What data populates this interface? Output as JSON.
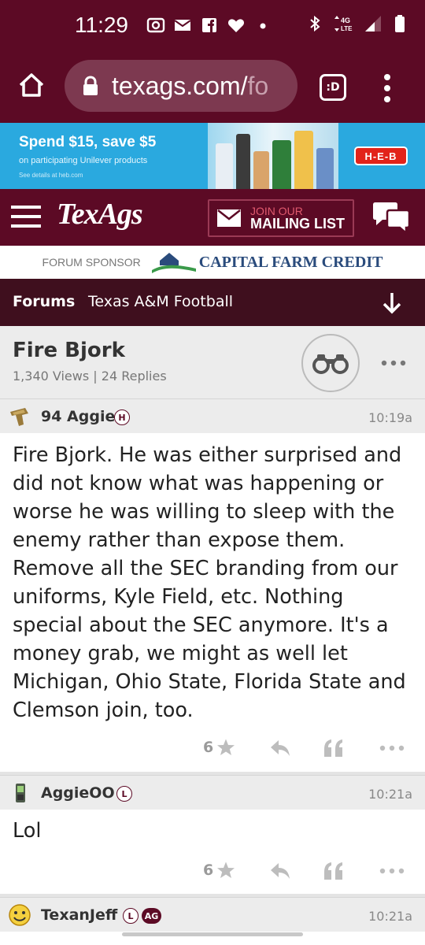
{
  "status_bar": {
    "time": "11:29",
    "icons_left": [
      "screen-record-icon",
      "mail-icon",
      "facebook-icon",
      "heart-icon",
      "dot-icon"
    ],
    "icons_right": [
      "bluetooth-icon",
      "4g-lte-icon",
      "signal-icon",
      "battery-icon"
    ],
    "network": "4G LTE"
  },
  "browser": {
    "url_main": "texags.com/",
    "url_faded": "fo",
    "discover_label": ":D"
  },
  "ad": {
    "headline": "Spend $15, save $5",
    "subline": "on participating Unilever products",
    "fine_print": "See details at heb.com",
    "brand": "H-E-B",
    "colors": {
      "background": "#2aa9df",
      "brand_red": "#e2231a"
    }
  },
  "site": {
    "logo": "TexAgs",
    "mailing_top": "JOIN OUR",
    "mailing_bottom": "MAILING LIST",
    "colors": {
      "maroon": "#5c0a25",
      "dark_maroon": "#3f0f1e"
    }
  },
  "sponsor": {
    "label": "FORUM SPONSOR",
    "name": "CAPITAL FARM CREDIT"
  },
  "breadcrumb": {
    "forums": "Forums",
    "board": "Texas A&M Football"
  },
  "thread": {
    "title": "Fire Bjork",
    "stats": "1,340 Views | 24 Replies"
  },
  "posts": [
    {
      "user": "94 Aggie",
      "badges": [
        "H"
      ],
      "time": "10:19a",
      "body": "Fire Bjork. He was either surprised and did not know what was happening or worse he was willing to sleep with the enemy rather than expose them. Remove all the SEC branding from our uniforms, Kyle Field, etc. Nothing special about the SEC anymore. It's a money grab, we might as well let Michigan, Ohio State, Florida State and Clemson join, too.",
      "rating": "6"
    },
    {
      "user": "AggieOO",
      "badges": [
        "L"
      ],
      "time": "10:21a",
      "body": "Lol",
      "rating": "6"
    },
    {
      "user": "TexanJeff",
      "badges": [
        "L",
        "AG"
      ],
      "time": "10:21a"
    }
  ]
}
